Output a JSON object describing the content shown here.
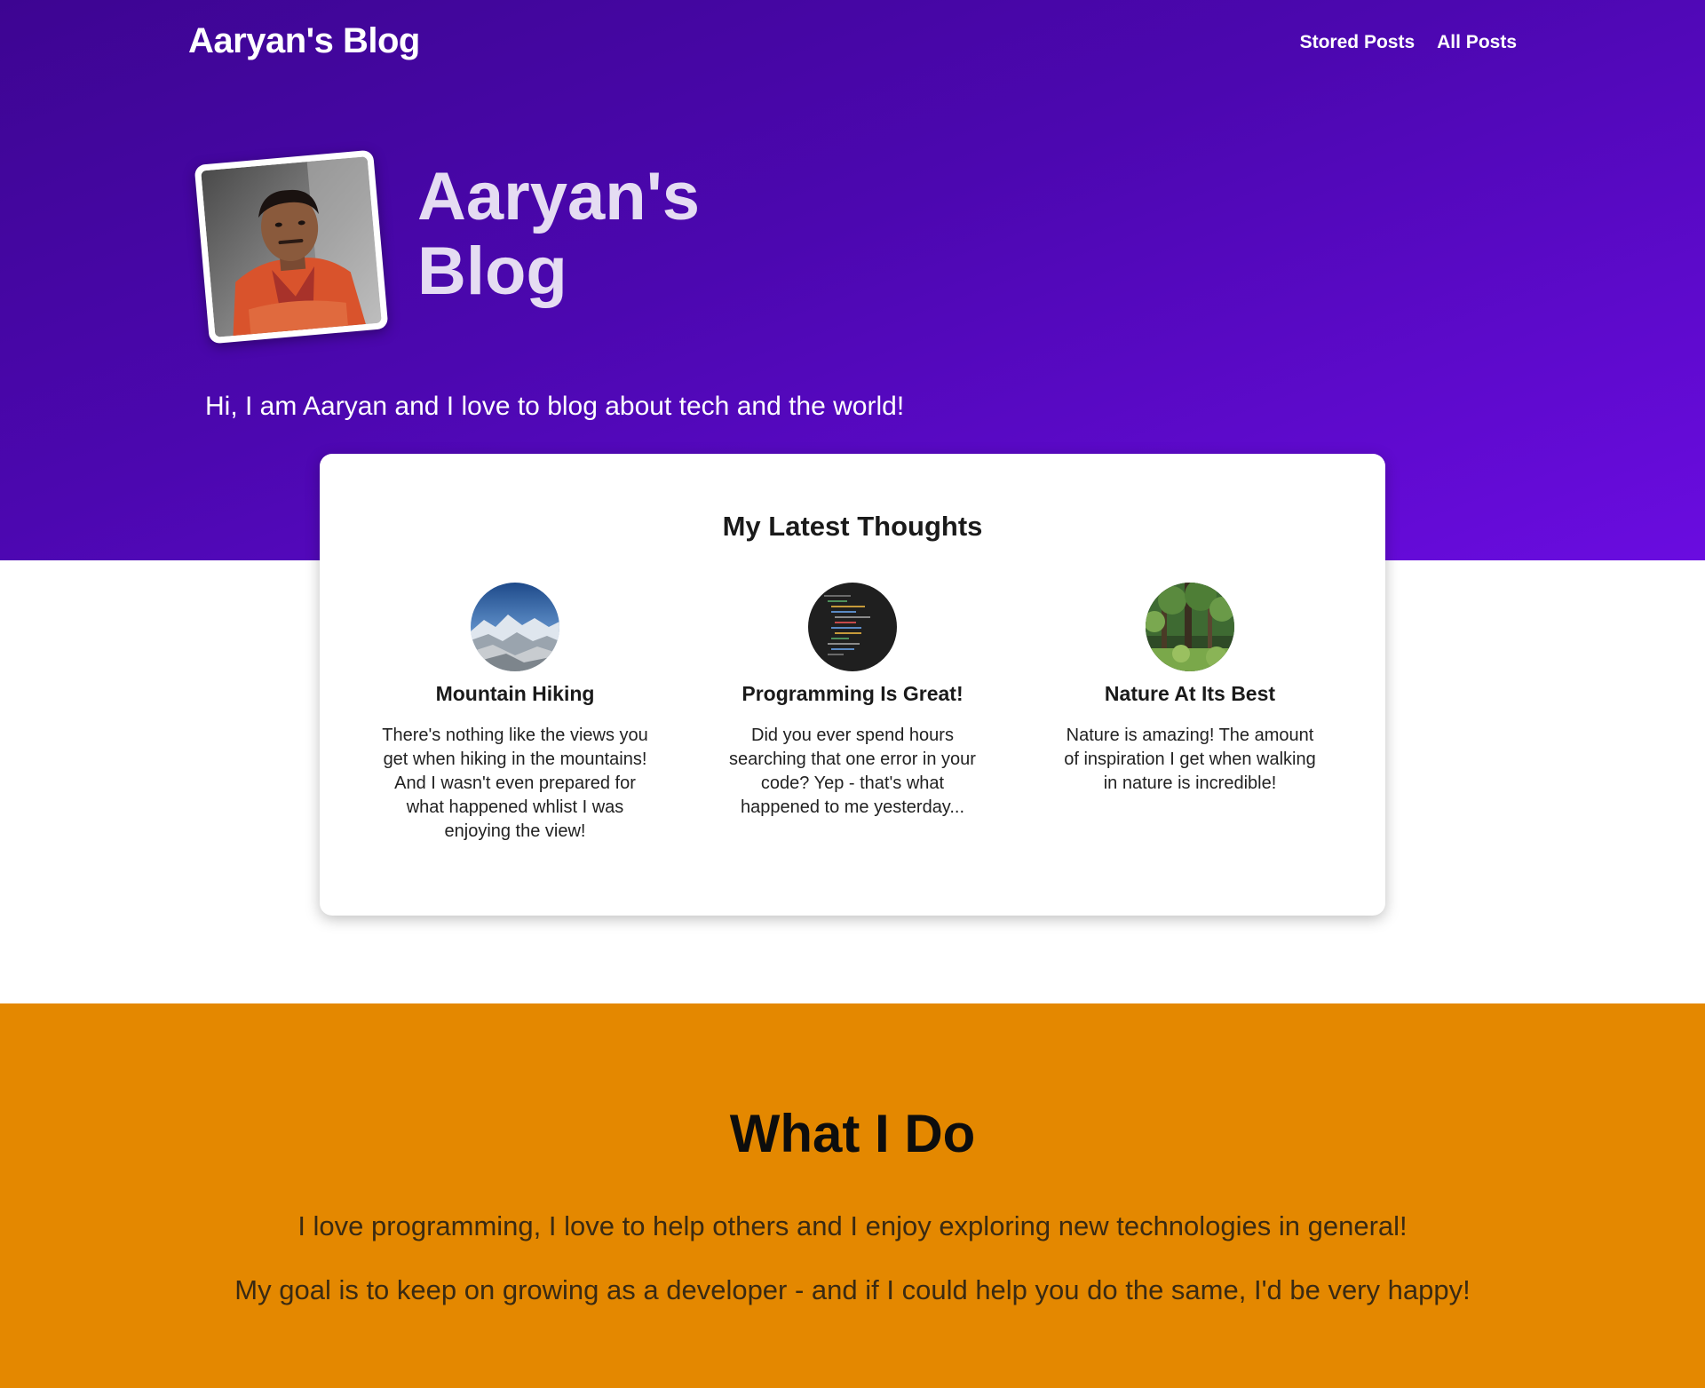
{
  "nav": {
    "logo": "Aaryan's Blog",
    "links": [
      {
        "label": "Stored Posts"
      },
      {
        "label": "All Posts"
      }
    ]
  },
  "hero": {
    "title": "Aaryan's Blog",
    "intro": "Hi, I am Aaryan and I love to blog about tech and the world!"
  },
  "latest": {
    "heading": "My Latest Thoughts",
    "posts": [
      {
        "title": "Mountain Hiking",
        "excerpt": "There's nothing like the views you get when hiking in the mountains! And I wasn't even prepared for what happened whlist I was enjoying the view!",
        "thumb_icon": "mountain-thumbnail"
      },
      {
        "title": "Programming Is Great!",
        "excerpt": "Did you ever spend hours searching that one error in your code? Yep - that's what happened to me yesterday...",
        "thumb_icon": "code-thumbnail"
      },
      {
        "title": "Nature At Its Best",
        "excerpt": "Nature is amazing! The amount of inspiration I get when walking in nature is incredible!",
        "thumb_icon": "forest-thumbnail"
      }
    ]
  },
  "whatido": {
    "title": "What I Do",
    "p1": "I love programming, I love to help others and I enjoy exploring new technologies in general!",
    "p2": "My goal is to keep on growing as a developer - and if I could help you do the same, I'd be very happy!"
  },
  "colors": {
    "hero_gradient_start": "#3d0592",
    "hero_gradient_end": "#6a0ce0",
    "accent_orange": "#e48800",
    "title_tint": "#e5dcf2"
  }
}
